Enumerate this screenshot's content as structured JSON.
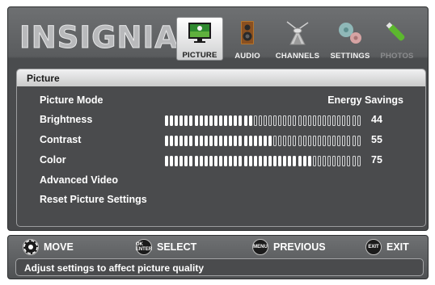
{
  "brand": "INSIGNIA",
  "tabs": [
    {
      "label": "PICTURE",
      "icon": "tv-picture-icon",
      "state": "active"
    },
    {
      "label": "AUDIO",
      "icon": "speaker-icon",
      "state": "normal"
    },
    {
      "label": "CHANNELS",
      "icon": "antenna-icon",
      "state": "normal"
    },
    {
      "label": "SETTINGS",
      "icon": "gears-icon",
      "state": "normal"
    },
    {
      "label": "PHOTOS",
      "icon": "usb-drive-icon",
      "state": "disabled"
    }
  ],
  "panel": {
    "title": "Picture",
    "picture_mode": {
      "label": "Picture Mode",
      "value": "Energy Savings"
    },
    "brightness": {
      "label": "Brightness",
      "value": 44
    },
    "contrast": {
      "label": "Contrast",
      "value": 55
    },
    "color": {
      "label": "Color",
      "value": 75
    },
    "advanced_video": {
      "label": "Advanced Video"
    },
    "reset": {
      "label": "Reset Picture Settings"
    }
  },
  "help": {
    "move": "MOVE",
    "select": "SELECT",
    "previous": "PREVIOUS",
    "exit": "EXIT",
    "ok_glyph": "OK ENTER",
    "menu_glyph": "MENU",
    "exit_glyph": "EXIT",
    "description": "Adjust settings to affect picture quality"
  },
  "colors": {
    "panel_bg": "#4a4b4d",
    "frame": "#5a5c5e",
    "active_tab": "#ffffff",
    "highlight_bar": "#e6e6e6"
  }
}
